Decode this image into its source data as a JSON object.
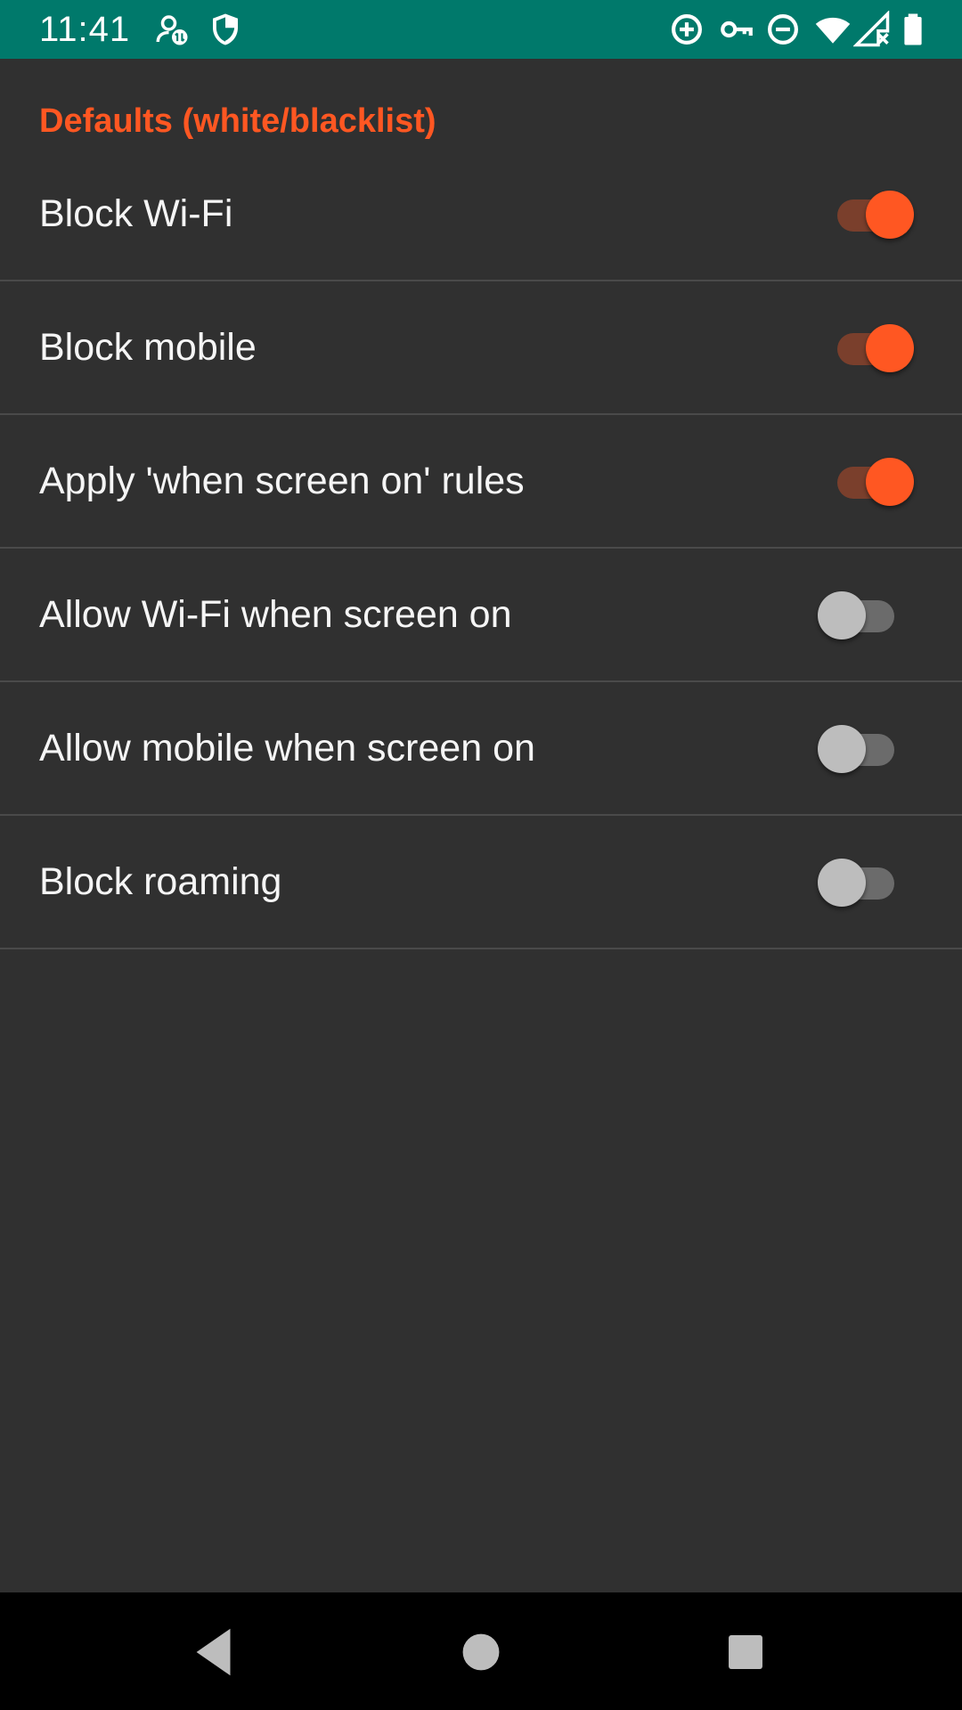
{
  "status_bar": {
    "time": "11:41",
    "bg_color": "#00796b",
    "left_icons": [
      "sync-account-icon",
      "shield-icon"
    ],
    "right_icons": [
      "data-saver-icon",
      "vpn-key-icon",
      "do-not-disturb-icon",
      "wifi-icon",
      "cellular-no-data-icon",
      "battery-icon"
    ]
  },
  "section": {
    "title": "Defaults (white/blacklist)",
    "accent_color": "#ff5722"
  },
  "preferences": [
    {
      "label": "Block Wi-Fi",
      "checked": true
    },
    {
      "label": "Block mobile",
      "checked": true
    },
    {
      "label": "Apply 'when screen on' rules",
      "checked": true
    },
    {
      "label": "Allow Wi-Fi when screen on",
      "checked": false
    },
    {
      "label": "Allow mobile when screen on",
      "checked": false
    },
    {
      "label": "Block roaming",
      "checked": false
    }
  ],
  "nav_bar": {
    "buttons": [
      "back-icon",
      "home-icon",
      "recents-icon"
    ]
  }
}
